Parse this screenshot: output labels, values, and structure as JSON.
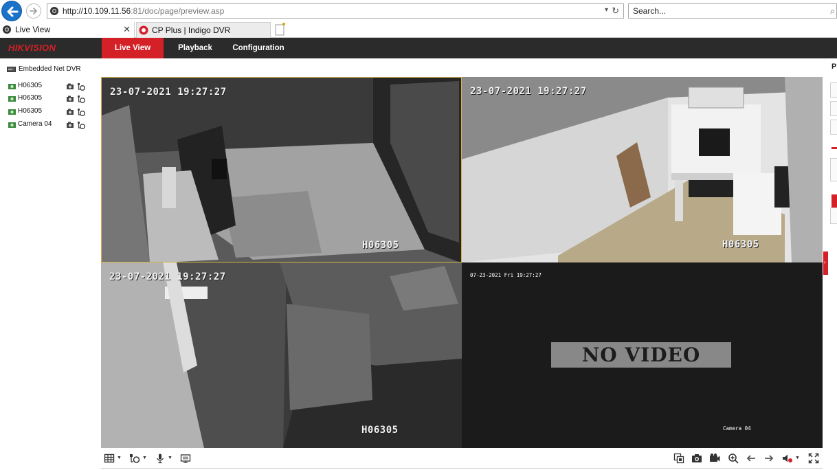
{
  "browser": {
    "url_host": "http://10.109.11.56",
    "url_path": ":81/doc/page/preview.asp",
    "search_placeholder": "Search...",
    "tabs": [
      {
        "label": "Live View"
      },
      {
        "label": "CP Plus | Indigo DVR"
      }
    ]
  },
  "app": {
    "logo": "HIKVISION",
    "nav": [
      {
        "label": "Live View",
        "active": true
      },
      {
        "label": "Playback"
      },
      {
        "label": "Configuration"
      }
    ],
    "device_label": "Embedded Net DVR",
    "cameras": [
      {
        "label": "H06305"
      },
      {
        "label": "H06305"
      },
      {
        "label": "H06305"
      },
      {
        "label": "Camera 04"
      }
    ],
    "right_panel_title": "P",
    "accent": "#d42027"
  },
  "video": {
    "tiles": [
      {
        "timestamp": "23-07-2021 19:27:27",
        "name": "H06305"
      },
      {
        "timestamp": "23-07-2021 19:27:27",
        "name": "H06305"
      },
      {
        "timestamp": "23-07-2021 19:27:27",
        "name": "H06305"
      },
      {
        "timestamp": "07-23-2021 Fri 19:27:27",
        "name": "Camera 04",
        "overlay": "NO VIDEO"
      }
    ]
  },
  "toolbar": {
    "left_icons": [
      "window-layout-icon",
      "stream-select-icon",
      "microphone-icon",
      "preview-all-icon"
    ],
    "right_icons": [
      "capture-list-icon",
      "camera-snapshot-icon",
      "record-icon",
      "zoom-in-icon",
      "previous-page-icon",
      "next-page-icon",
      "volume-icon",
      "fullscreen-icon"
    ]
  }
}
